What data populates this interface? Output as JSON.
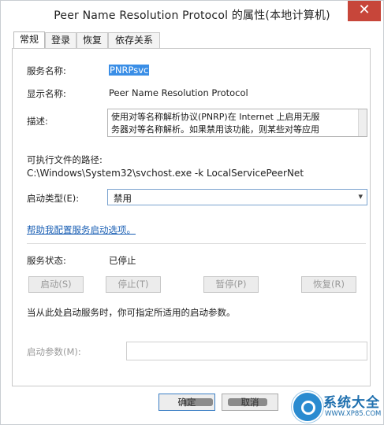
{
  "window": {
    "title": "Peer Name Resolution Protocol 的属性(本地计算机)",
    "close_label": "✕",
    "colors": {
      "close": "#c7463a",
      "link": "#1a5fb4",
      "selection": "#3a8ee6"
    }
  },
  "tabs": [
    "常规",
    "登录",
    "恢复",
    "依存关系"
  ],
  "active_tab": "常规",
  "general": {
    "service_name_label": "服务名称:",
    "service_name_value": "PNRPsvc",
    "display_name_label": "显示名称:",
    "display_name_value": "Peer Name Resolution Protocol",
    "description_label": "描述:",
    "description_line1": "使用对等名称解析协议(PNRP)在 Internet 上启用无服",
    "description_line2": "务器对等名称解析。如果禁用该功能，则某些对等应用",
    "exe_path_label": "可执行文件的路径:",
    "exe_path_value": "C:\\Windows\\System32\\svchost.exe -k LocalServicePeerNet",
    "startup_type_label": "启动类型(E):",
    "startup_type_value": "禁用",
    "help_link": "帮助我配置服务启动选项。",
    "service_status_label": "服务状态:",
    "service_status_value": "已停止",
    "start_button": "启动(S)",
    "stop_button": "停止(T)",
    "pause_button": "暂停(P)",
    "resume_button": "恢复(R)",
    "start_hint": "当从此处启动服务时，你可指定所适用的启动参数。",
    "start_params_label": "启动参数(M):",
    "start_params_value": ""
  },
  "footer": {
    "ok_button": "确定",
    "cancel_button": "取消"
  },
  "watermark": {
    "brand": "系统大全",
    "url": "WWW.XP85.COM"
  }
}
